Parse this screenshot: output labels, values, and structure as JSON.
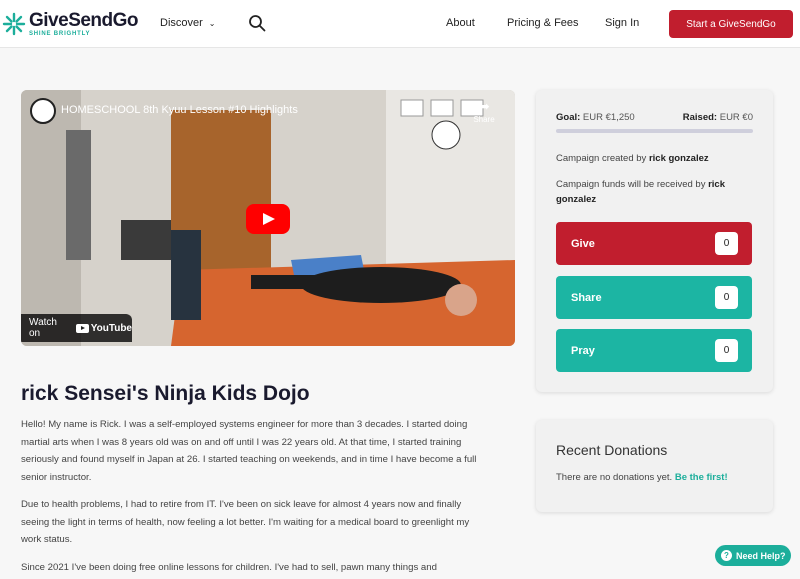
{
  "header": {
    "logo_text": "GiveSendGo",
    "logo_tagline": "SHINE BRIGHTLY",
    "discover_label": "Discover",
    "nav": {
      "about": "About",
      "pricing": "Pricing & Fees",
      "signin": "Sign In"
    },
    "start_button": "Start a GiveSendGo"
  },
  "video": {
    "title": "HOMESCHOOL 8th Kyuu Lesson #10 Highlights",
    "share_label": "Share",
    "watch_on": "Watch on",
    "youtube_label": "YouTube"
  },
  "campaign": {
    "title": "rick Sensei's Ninja Kids Dojo",
    "paragraphs": [
      "Hello! My name is Rick. I was a self-employed systems engineer for more than 3 decades. I started doing martial arts when I was 8 years old was on and off until I was 22 years old. At that time, I started training seriously and found myself in Japan at 26. I started teaching on weekends, and in time I have become a full senior instructor.",
      "Due to health problems, I had to retire from IT. I've been on sick leave for almost 4 years now and finally seeing the light in terms of health, now feeling a lot better. I'm waiting for a medical board to greenlight my work status.",
      "Since 2021 I've been doing free online lessons for children. I've had to sell, pawn many things and"
    ]
  },
  "sidebar": {
    "goal_label": "Goal:",
    "goal_value": "EUR €1,250",
    "raised_label": "Raised:",
    "raised_value": "EUR €0",
    "progress_fraction": 0,
    "created_prefix": "Campaign created by",
    "created_by": "rick gonzalez",
    "funds_prefix": "Campaign funds will be received by",
    "funds_recipient": "rick gonzalez",
    "buttons": [
      {
        "label": "Give",
        "count": "0"
      },
      {
        "label": "Share",
        "count": "0"
      },
      {
        "label": "Pray",
        "count": "0"
      }
    ]
  },
  "recent_donations": {
    "title": "Recent Donations",
    "empty_text": "There are no donations yet.",
    "cta": "Be the first!"
  },
  "help": {
    "label": "Need Help?"
  },
  "colors": {
    "brand_red": "#c11e2e",
    "brand_teal": "#1cb5a3"
  }
}
